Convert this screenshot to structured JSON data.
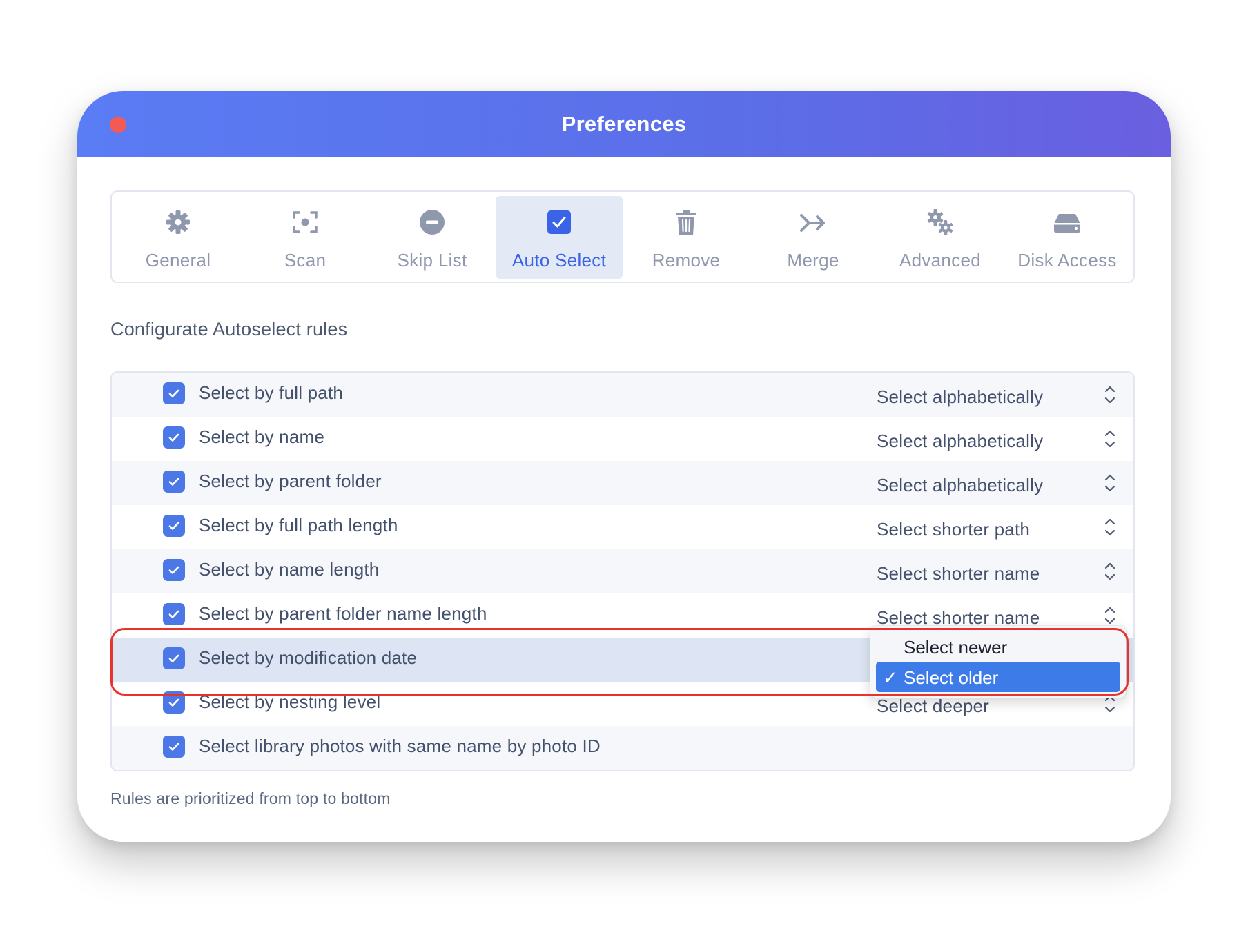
{
  "window": {
    "title": "Preferences"
  },
  "tabs": [
    {
      "label": "General",
      "icon": "gear-icon"
    },
    {
      "label": "Scan",
      "icon": "scan-frame-icon"
    },
    {
      "label": "Skip List",
      "icon": "minus-circle-icon"
    },
    {
      "label": "Auto Select",
      "icon": "checkbox-icon",
      "active": true
    },
    {
      "label": "Remove",
      "icon": "trash-icon"
    },
    {
      "label": "Merge",
      "icon": "merge-arrow-icon"
    },
    {
      "label": "Advanced",
      "icon": "gears-icon"
    },
    {
      "label": "Disk Access",
      "icon": "disk-icon"
    }
  ],
  "section_title": "Configurate Autoselect rules",
  "rules": [
    {
      "label": "Select by full path",
      "checked": true,
      "option": "Select alphabetically"
    },
    {
      "label": "Select by name",
      "checked": true,
      "option": "Select alphabetically"
    },
    {
      "label": "Select by parent folder",
      "checked": true,
      "option": "Select alphabetically"
    },
    {
      "label": "Select by full path length",
      "checked": true,
      "option": "Select shorter path"
    },
    {
      "label": "Select by name length",
      "checked": true,
      "option": "Select shorter name"
    },
    {
      "label": "Select by parent folder name length",
      "checked": true,
      "option": "Select shorter name"
    },
    {
      "label": "Select by modification date",
      "checked": true,
      "option": "Select older"
    },
    {
      "label": "Select by nesting level",
      "checked": true,
      "option": "Select deeper"
    },
    {
      "label": "Select library photos with same name by photo ID",
      "checked": true,
      "option": ""
    }
  ],
  "footnote": "Rules are prioritized from top to bottom",
  "dropdown": {
    "options": [
      {
        "label": "Select newer",
        "selected": false
      },
      {
        "label": "Select older",
        "selected": true
      }
    ],
    "check_glyph": "✓"
  },
  "colors": {
    "titlebar_start": "#5a7cf4",
    "titlebar_end": "#6a5fe0",
    "accent": "#3b63e8",
    "checkbox": "#4b78e6",
    "highlight_row": "#dde5f4",
    "callout": "#e8332c",
    "close_button": "#f25a55"
  }
}
